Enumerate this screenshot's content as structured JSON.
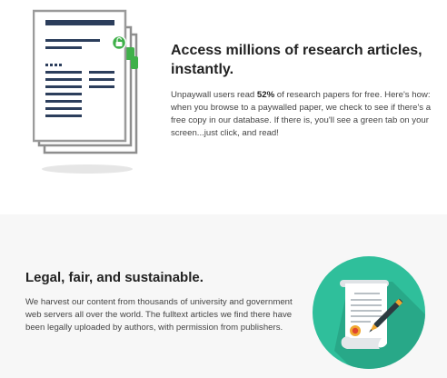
{
  "access": {
    "heading": "Access millions of research articles, instantly.",
    "text_before": "Unpaywall users read ",
    "highlight": "52%",
    "text_after": " of research papers for free. Here's how: when you browse to a paywalled paper, we check to see if there's a free copy in our database. If there is, you'll see a green tab on your screen...just click, and read!"
  },
  "legal": {
    "heading": "Legal, fair, and sustainable.",
    "body": "We harvest our content from thousands of university and government web servers all over the world. The fulltext articles we find there have been legally uploaded by authors, with permission from publishers."
  },
  "colors": {
    "green": "#3fb04a",
    "teal": "#2fbf9b",
    "teal_shadow": "#27a385",
    "navy": "#2c3e5c",
    "doc_border": "#9a9a9a",
    "section_bg": "#f7f7f7"
  },
  "icons": {
    "documents": "stacked-documents-with-unlock-tabs",
    "certificate": "certificate-scroll-with-pen"
  }
}
